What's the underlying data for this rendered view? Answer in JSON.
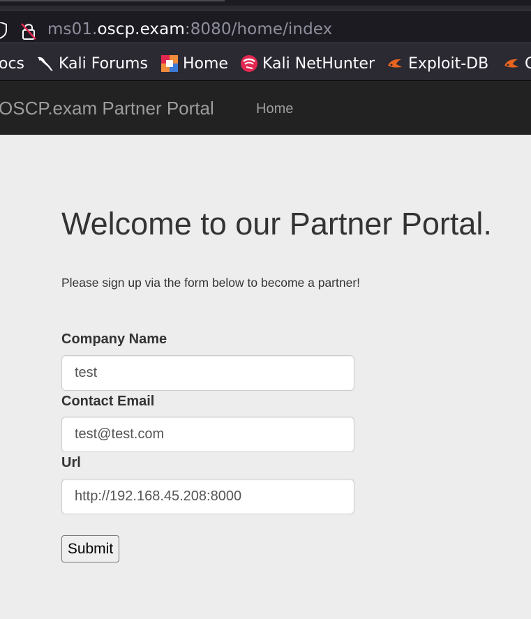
{
  "browser": {
    "url": {
      "subdomain": "ms01.",
      "host": "oscp.exam",
      "rest": ":8080/home/index"
    },
    "bookmarks": [
      {
        "label": "ocs",
        "icon": "none"
      },
      {
        "label": "Kali Forums",
        "icon": "kali-dragon-icon"
      },
      {
        "label": "Home",
        "icon": "offsec-icon"
      },
      {
        "label": "Kali NetHunter",
        "icon": "nethunter-icon"
      },
      {
        "label": "Exploit-DB",
        "icon": "exploitdb-icon"
      },
      {
        "label": "G",
        "icon": "exploitdb-icon"
      }
    ]
  },
  "navbar": {
    "brand": "OSCP.exam Partner Portal",
    "home": "Home"
  },
  "main": {
    "title": "Welcome to our Partner Portal.",
    "lead": "Please sign up via the form below to become a partner!",
    "form": {
      "company_label": "Company Name",
      "company_value": "test",
      "email_label": "Contact Email",
      "email_value": "test@test.com",
      "url_label": "Url",
      "url_value": "http://192.168.45.208:8000",
      "submit": "Submit"
    }
  },
  "colors": {
    "navbar_bg": "#222222",
    "page_bg": "#ededed",
    "browser_bg": "#2b2a33",
    "urlbar_bg": "#1c1b22"
  }
}
